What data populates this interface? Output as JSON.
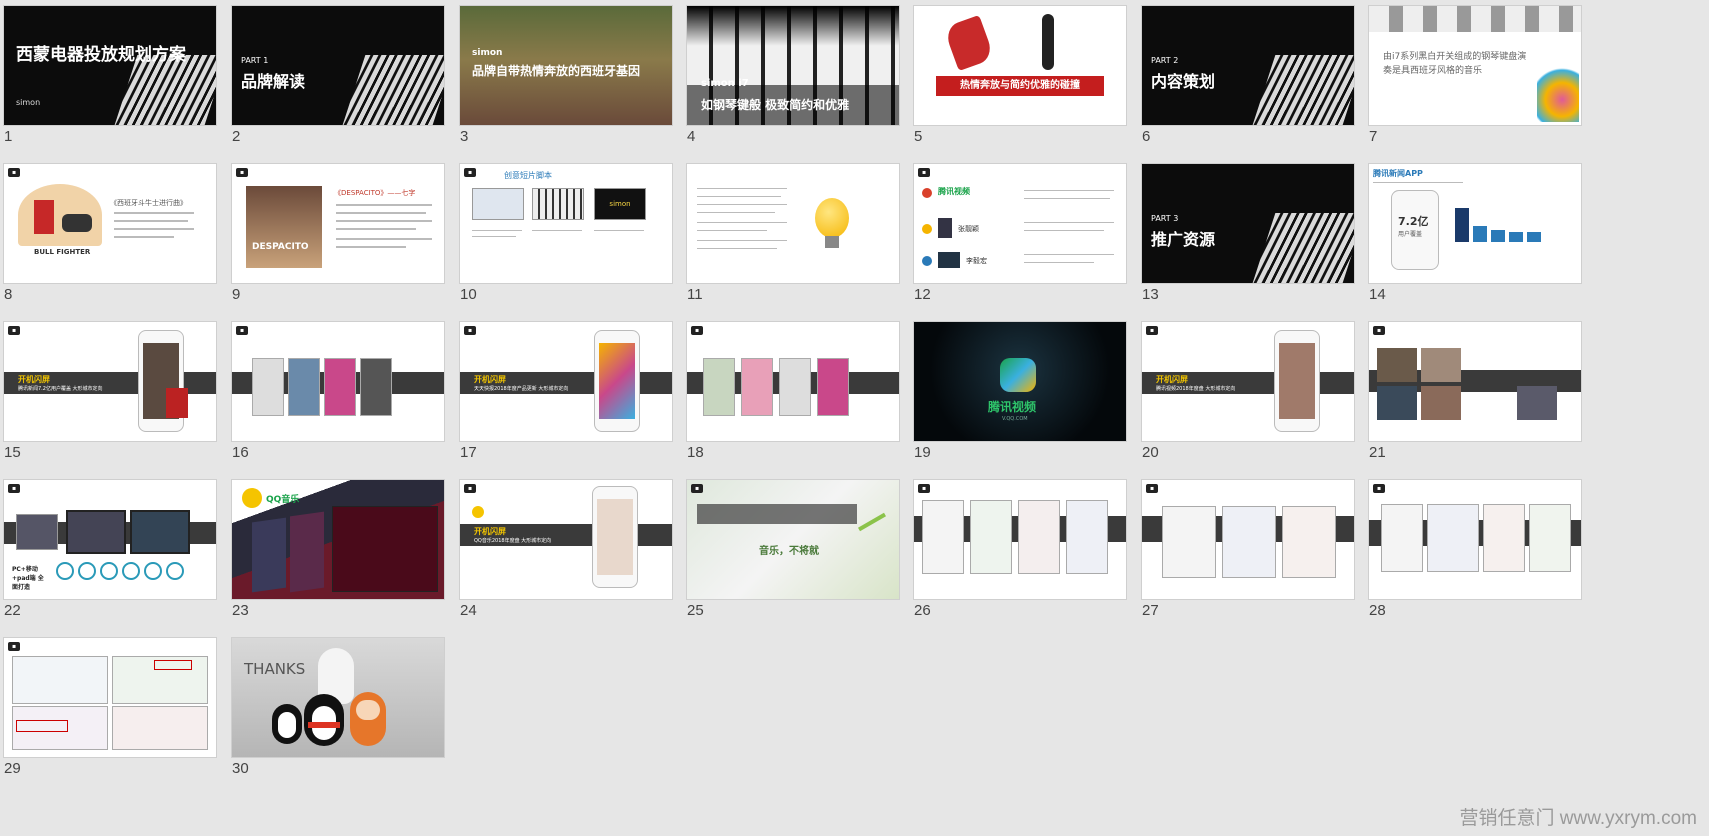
{
  "slides": [
    {
      "num": "1",
      "title": "西蒙电器投放规划方案",
      "brand": "simon"
    },
    {
      "num": "2",
      "part": "PART 1",
      "title": "品牌解读"
    },
    {
      "num": "3",
      "brand": "simon",
      "title": "品牌自带热情奔放的西班牙基因"
    },
    {
      "num": "4",
      "brand": "simon i7",
      "title": "如钢琴键般 极致简约和优雅"
    },
    {
      "num": "5",
      "banner": "热情奔放与简约优雅的碰撞"
    },
    {
      "num": "6",
      "part": "PART 2",
      "title": "内容策划"
    },
    {
      "num": "7",
      "text": "由i7系列黑白开关组成的钢琴键盘演奏是具西班牙风格的音乐"
    },
    {
      "num": "8",
      "caption": "BULL FIGHTER",
      "heading": "《西班牙斗牛士进行曲》"
    },
    {
      "num": "9",
      "heading": "《DESPACITO》——七字",
      "cover": "DESPACITO"
    },
    {
      "num": "10",
      "heading": "创意短片脚本",
      "brand": "simon"
    },
    {
      "num": "11"
    },
    {
      "num": "12",
      "logo": "腾讯视频",
      "items": [
        "张靓颖",
        "李毅宏"
      ]
    },
    {
      "num": "13",
      "part": "PART 3",
      "title": "推广资源"
    },
    {
      "num": "14",
      "heading": "腾讯新闻APP",
      "stat": "7.2亿",
      "stat_label": "用户覆盖"
    },
    {
      "num": "15",
      "band_title": "开机闪屏",
      "band_sub": "腾讯新闻7.2亿用户覆盖 大形城市定向"
    },
    {
      "num": "16"
    },
    {
      "num": "17",
      "band_title": "开机闪屏",
      "band_sub": "天天快报2018年度产品更新 大形城市定向"
    },
    {
      "num": "18"
    },
    {
      "num": "19",
      "logo": "腾讯视频",
      "logo_sub": "V.QQ.COM"
    },
    {
      "num": "20",
      "band_title": "开机闪屏",
      "band_sub": "腾讯视频2018年度盘 大形城市定向"
    },
    {
      "num": "21"
    },
    {
      "num": "22",
      "bottom_text": "PC+移动+pad端 全面打造"
    },
    {
      "num": "23",
      "logo": "QQ音乐"
    },
    {
      "num": "24",
      "band_title": "开机闪屏",
      "band_sub": "QQ音乐2018年度盘 大形城市定向"
    },
    {
      "num": "25",
      "center_text": "音乐，不将就"
    },
    {
      "num": "26"
    },
    {
      "num": "27"
    },
    {
      "num": "28"
    },
    {
      "num": "29"
    },
    {
      "num": "30",
      "text": "THANKS"
    }
  ],
  "watermark": "营销任意门 www.yxrym.com"
}
